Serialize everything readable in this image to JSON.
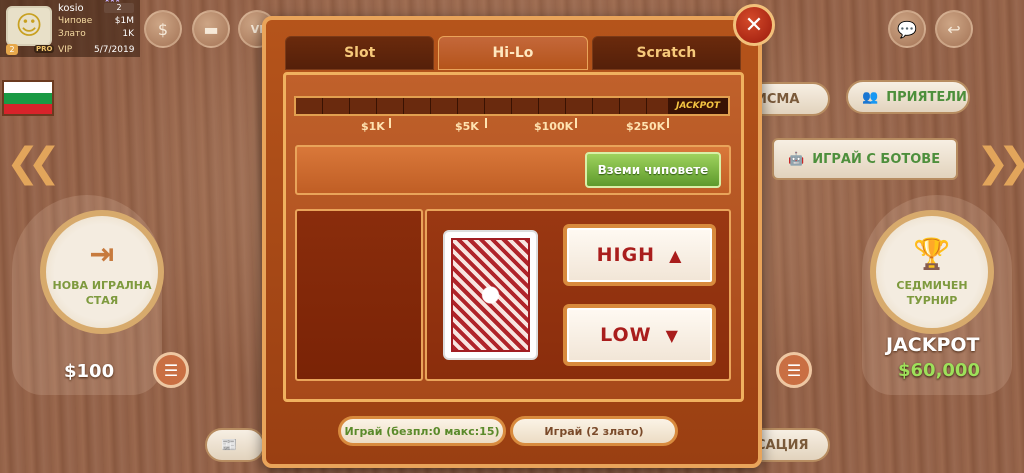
{
  "profile": {
    "username": "kosio",
    "level": "2",
    "chips_label": "Чипове",
    "chips_value": "$1M",
    "gold_label": "Злато",
    "gold_value": "1K",
    "badge_count": "2",
    "pro_label": "PRO",
    "vip_label": "VIP",
    "date": "5/7/2019"
  },
  "topbar_icons": [
    "chips-icon",
    "gold-icon",
    "vip-icon",
    "chat-icon",
    "back-icon"
  ],
  "background": {
    "new_room_label": "НОВА ИГРАЛНА СТАЯ",
    "left_amount": "$100",
    "weekly_tournament_label": "СЕДМИЧЕН ТУРНИР",
    "jackpot_label": "JACKPOT",
    "jackpot_value": "$60,000",
    "messages_label": "ИСМА",
    "friends_label": "ПРИЯТЕЛИ",
    "bots_label": "ИГРАЙ С БОТОВЕ",
    "transaction_label": "САЦИЯ",
    "vip_label": "VI"
  },
  "modal": {
    "tabs": [
      {
        "label": "Slot",
        "active": false
      },
      {
        "label": "Hi-Lo",
        "active": true
      },
      {
        "label": "Scratch",
        "active": false
      }
    ],
    "progress_cells": 16,
    "jackpot_tag": "JACKPOT",
    "marks": [
      "$1K",
      "$5K",
      "$100K",
      "$250K"
    ],
    "collect_label": "Вземи чиповете",
    "high_label": "HIGH",
    "low_label": "LOW",
    "play_free_label": "Играй (безпл:0 макс:15)",
    "play_gold_label": "Играй (2 злато)"
  },
  "colors": {
    "accent_gold": "#e9a45a",
    "modal_bg": "#b5541b",
    "button_green": "#6fa93a",
    "text_red": "#a91d1c"
  }
}
